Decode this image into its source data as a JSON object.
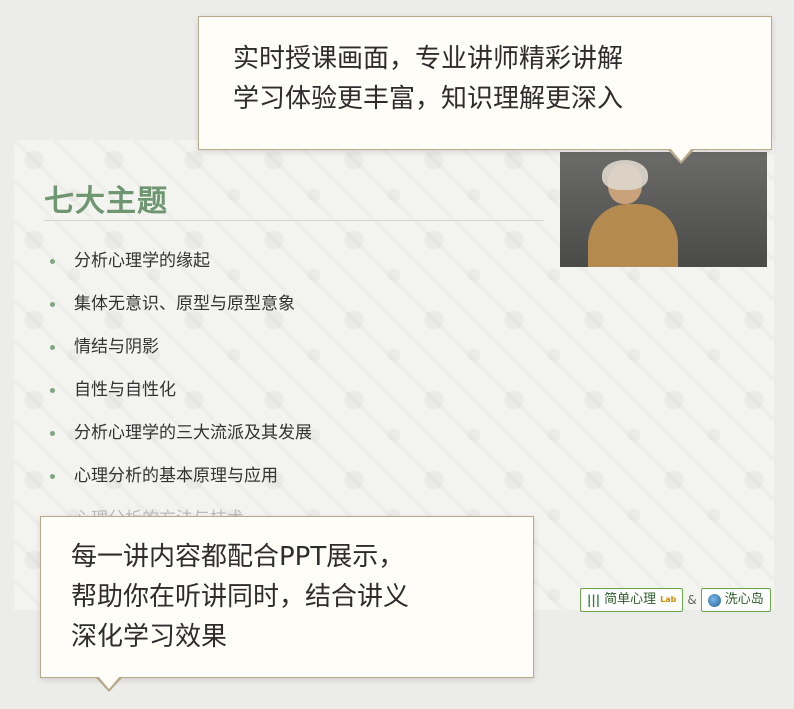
{
  "callouts": {
    "top": [
      "实时授课画面，专业讲师精彩讲解",
      "学习体验更丰富，知识理解更深入"
    ],
    "bottom": [
      "每一讲内容都配合PPT展示，",
      "帮助你在听讲同时，结合讲义",
      "深化学习效果"
    ]
  },
  "slide": {
    "title": "七大主题",
    "topics": [
      "分析心理学的缘起",
      "集体无意识、原型与原型意象",
      "情结与阴影",
      "自性与自性化",
      "分析心理学的三大流派及其发展",
      "心理分析的基本原理与应用",
      "心理分析的方法与技术"
    ],
    "accent_color": "#6e9670"
  },
  "brands": {
    "left": "简单心理",
    "left_tag": "Lab",
    "separator": "&",
    "right": "洗心岛"
  }
}
